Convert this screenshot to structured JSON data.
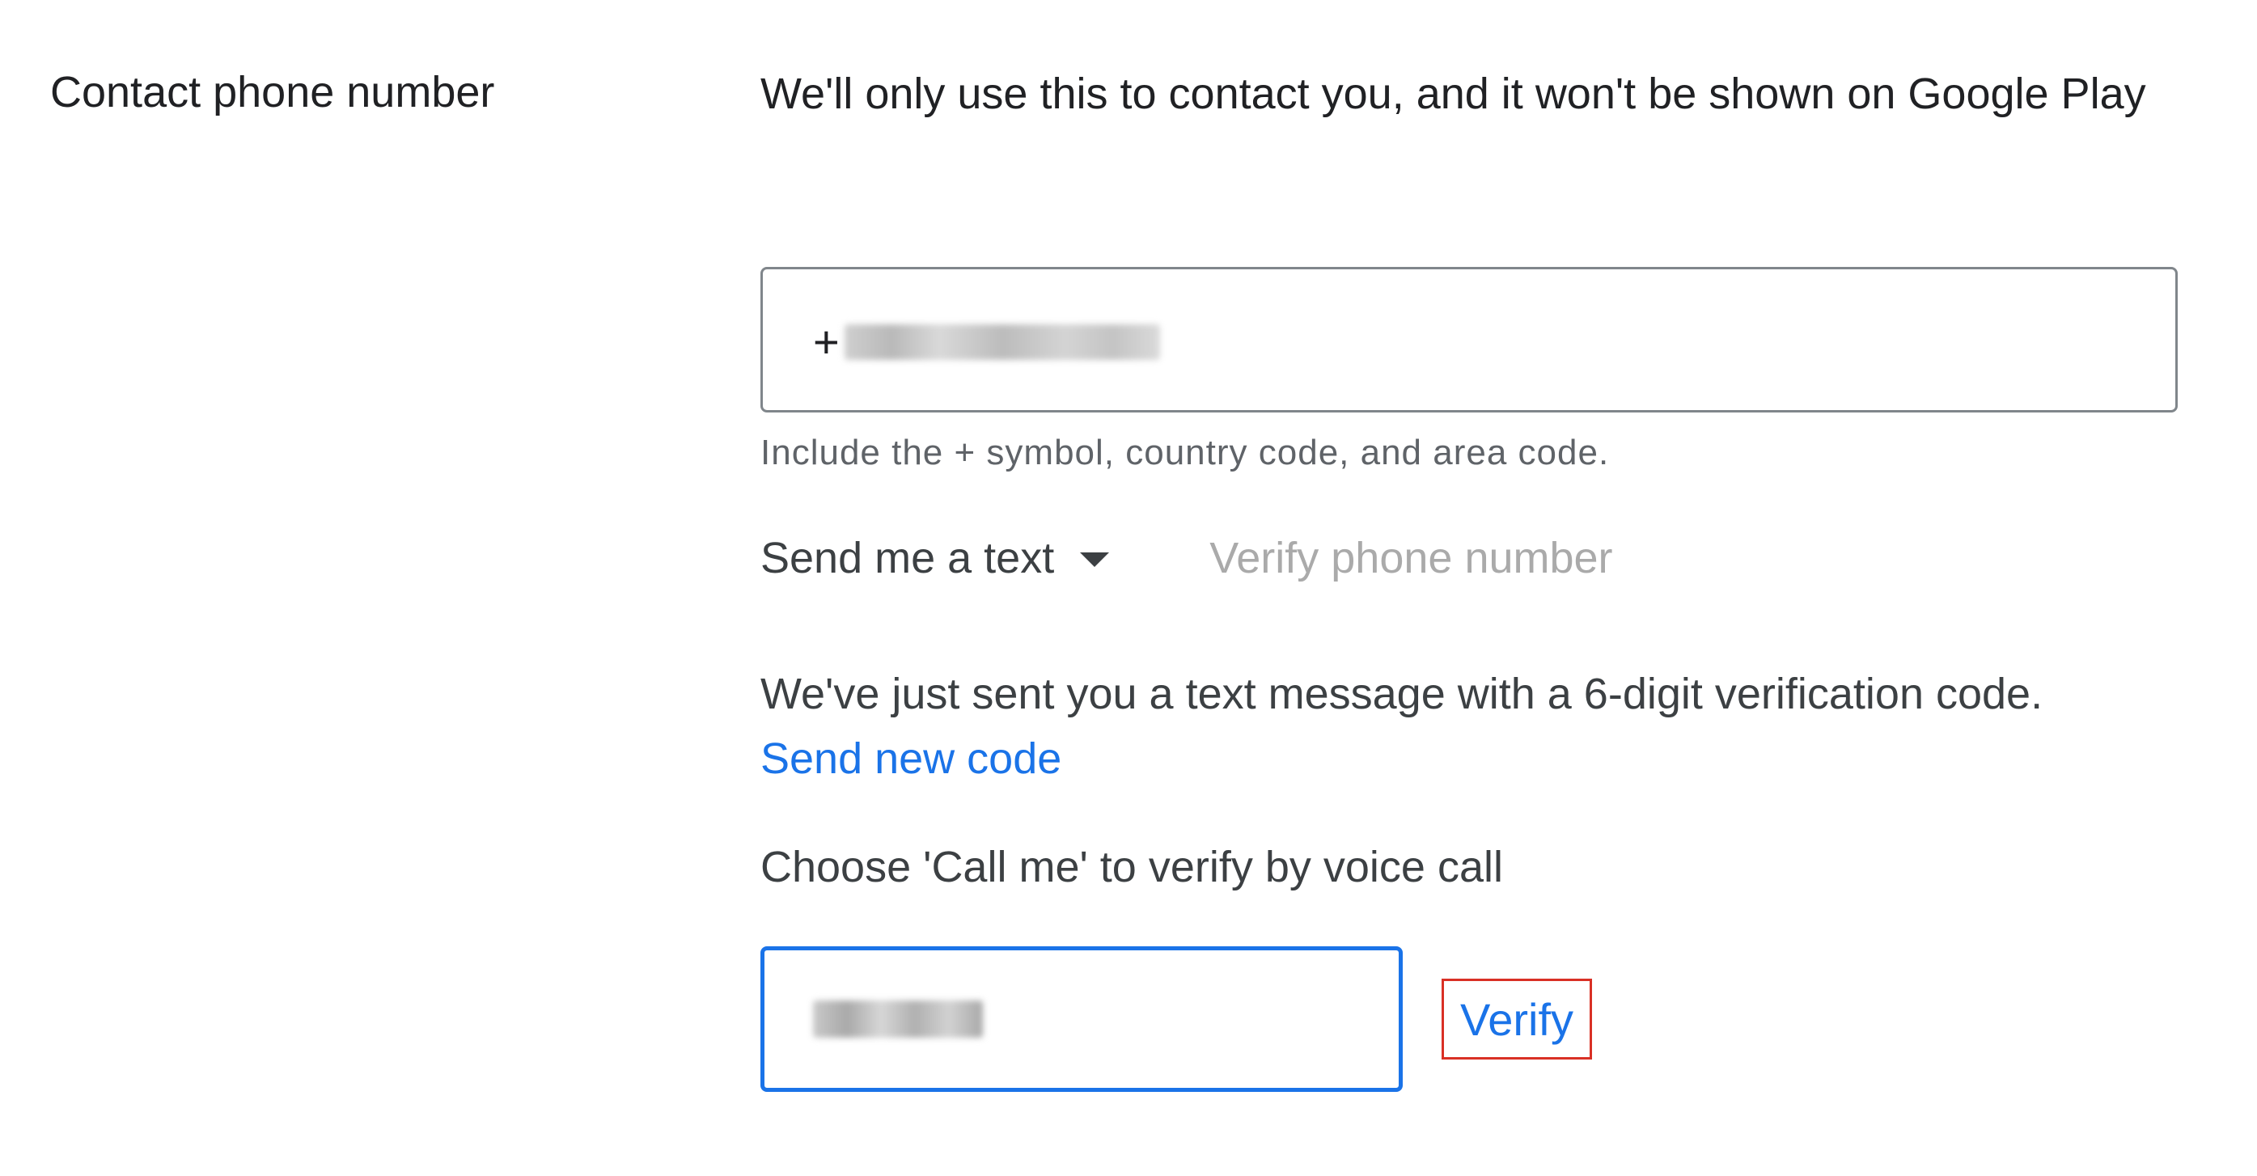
{
  "section": {
    "label": "Contact phone number",
    "description": "We'll only use this to contact you, and it won't be shown on Google Play"
  },
  "phone": {
    "prefix": "+",
    "helper": "Include the + symbol, country code, and area code."
  },
  "method": {
    "selected": "Send me a text",
    "verify_phone_label": "Verify phone number"
  },
  "verification": {
    "sent_message": "We've just sent you a text message with a 6-digit verification code.",
    "send_new_code": "Send new code",
    "call_hint": "Choose 'Call me' to verify by voice call",
    "verify_label": "Verify"
  },
  "colors": {
    "link_blue": "#1a73e8",
    "highlight_red": "#d93025",
    "disabled_gray": "#aaaaaa"
  },
  "icons": {
    "method_dropdown": "caret-down-icon"
  }
}
